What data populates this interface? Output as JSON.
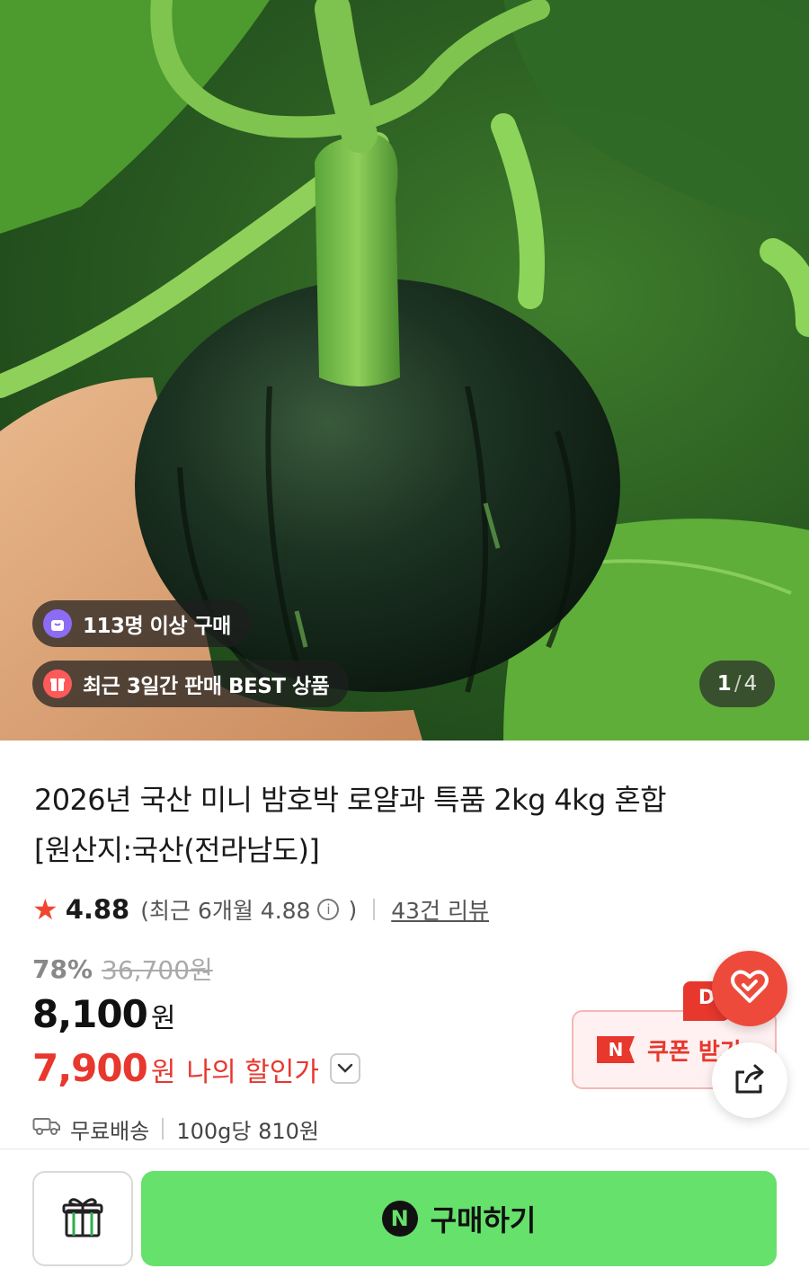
{
  "hero": {
    "badges": [
      {
        "icon": "bag-icon",
        "text": "113명 이상 구매"
      },
      {
        "icon": "gift-box-icon",
        "text": "최근 3일간 판매 BEST 상품"
      }
    ],
    "pager": {
      "current": "1",
      "separator": "/",
      "total": "4"
    }
  },
  "product": {
    "title_line1": "2026년 국산 미니 밤호박 로얄과 특품 2kg 4kg 혼합",
    "title_line2": "[원산지:국산(전라남도)]",
    "rating": {
      "score": "4.88",
      "recent_prefix": "(최근 6개월 4.88",
      "recent_suffix": ")",
      "reviews": "43건 리뷰"
    },
    "discount_rate": "78%",
    "original_price": "36,700원",
    "price": "8,100",
    "price_unit": "원",
    "my_price": "7,900",
    "my_price_unit": "원",
    "my_price_label": "나의 할인가",
    "shipping": "무료배송",
    "unit_price": "100g당 810원"
  },
  "coupon": {
    "label": "쿠폰 받기",
    "logo": "N",
    "tag": "D"
  },
  "bottom_bar": {
    "buy_label": "구매하기",
    "buy_logo": "N"
  },
  "colors": {
    "accent_red": "#e8372d",
    "buy_green": "#66e16b",
    "star": "#f0462f"
  }
}
